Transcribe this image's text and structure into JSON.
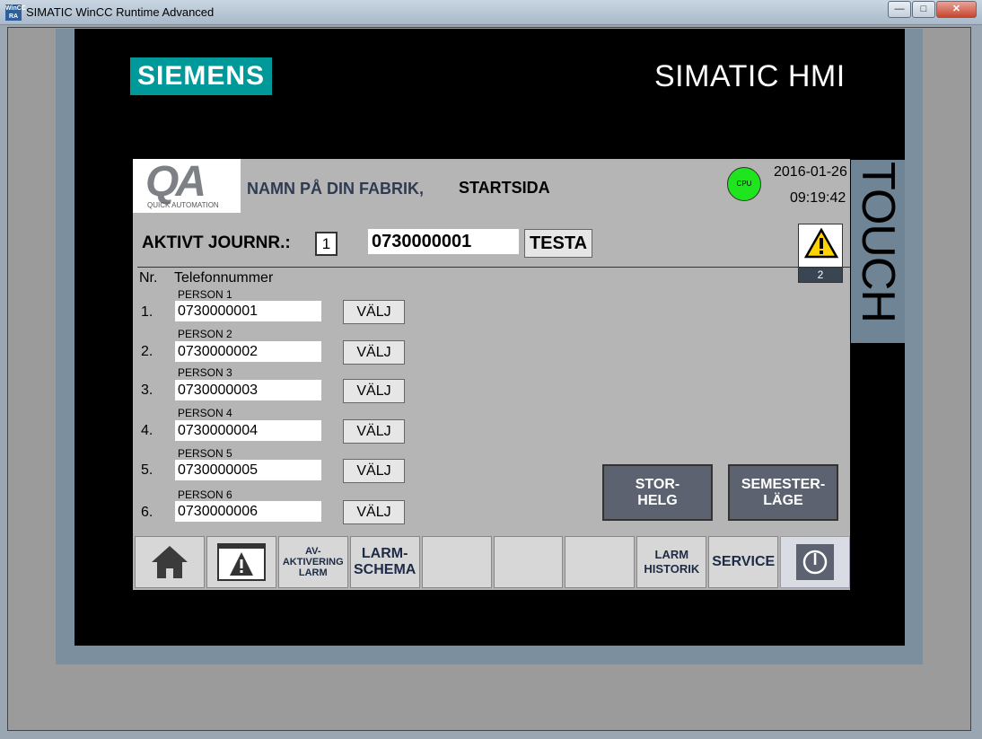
{
  "window": {
    "title": "SIMATIC WinCC Runtime Advanced",
    "app_icon_text": "WinCC RA"
  },
  "hmi": {
    "brand_logo": "SIEMENS",
    "product": "SIMATIC HMI",
    "side_label": "TOUCH"
  },
  "header": {
    "qa_logo": "QA",
    "qa_subtitle": "QUICK AUTOMATION",
    "factory": "NAMN PÅ DIN FABRIK,",
    "page": "STARTSIDA",
    "cpu_label": "CPU",
    "date": "2016-01-26",
    "time": "09:19:42",
    "alarm_count": "2"
  },
  "active": {
    "label": "AKTIVT JOURNR.:",
    "journal_nr": "1",
    "number": "0730000001",
    "test_label": "TESTA"
  },
  "table": {
    "col_nr": "Nr.",
    "col_phone": "Telefonnummer",
    "select_label": "VÄLJ",
    "rows": [
      {
        "nr": "1.",
        "person": "PERSON 1",
        "phone": "0730000001"
      },
      {
        "nr": "2.",
        "person": "PERSON 2",
        "phone": "0730000002"
      },
      {
        "nr": "3.",
        "person": "PERSON 3",
        "phone": "0730000003"
      },
      {
        "nr": "4.",
        "person": "PERSON 4",
        "phone": "0730000004"
      },
      {
        "nr": "5.",
        "person": "PERSON 5",
        "phone": "0730000005"
      },
      {
        "nr": "6.",
        "person": "PERSON 6",
        "phone": "0730000006"
      }
    ]
  },
  "modes": {
    "storhelg": [
      "STOR-",
      "HELG"
    ],
    "semester": [
      "SEMESTER-",
      "LÄGE"
    ]
  },
  "nav": {
    "deactivate": [
      "AV-",
      "AKTIVERING",
      "LARM"
    ],
    "larm_schema": [
      "LARM-",
      "SCHEMA"
    ],
    "larm_historik": [
      "LARM",
      "HISTORIK"
    ],
    "service": "SERVICE"
  },
  "colors": {
    "siemens_teal": "#009999",
    "cpu_ok": "#1ee51e",
    "hmi_panel": "#b5b5b5",
    "mode_button": "#5c6270"
  }
}
